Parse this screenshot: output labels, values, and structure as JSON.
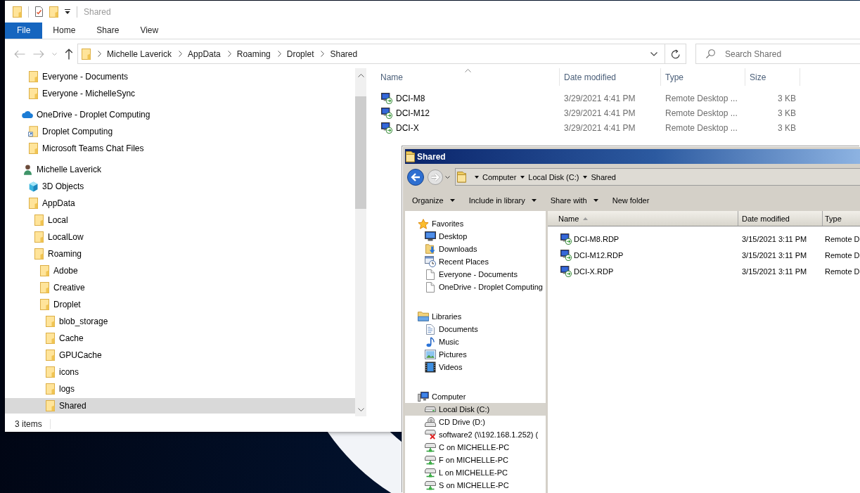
{
  "explorer": {
    "title": "Shared",
    "ribbon_tabs": [
      {
        "label": "File",
        "kind": "menu"
      },
      {
        "label": "Home",
        "kind": "tab"
      },
      {
        "label": "Share",
        "kind": "tab"
      },
      {
        "label": "View",
        "kind": "tab"
      }
    ],
    "nav_buttons": [
      {
        "kind": "back",
        "disabled": true
      },
      {
        "kind": "forward",
        "disabled": true
      },
      {
        "kind": "recent",
        "disabled": true
      },
      {
        "kind": "up",
        "disabled": false
      }
    ],
    "address": [
      "Michelle Laverick",
      "AppData",
      "Roaming",
      "Droplet",
      "Shared"
    ],
    "search": {
      "placeholder": "Search Shared"
    },
    "nav": [
      {
        "children": [
          {
            "label": "Everyone - Documents",
            "kind": "folder",
            "selected": false
          },
          {
            "label": "Everyone - MichelleSync",
            "kind": "folder",
            "selected": false
          }
        ]
      },
      {
        "label": "OneDrive - Droplet Computing",
        "kind": "cloud",
        "selected": false,
        "children": [
          {
            "label": "Droplet Computing",
            "kind": "shortcut",
            "selected": false
          },
          {
            "label": "Microsoft Teams Chat Files",
            "kind": "folder",
            "selected": false
          }
        ]
      },
      {
        "label": "Michelle Laverick",
        "kind": "user",
        "selected": false,
        "children": [
          {
            "label": "3D Objects",
            "kind": "cube",
            "selected": false
          },
          {
            "label": "AppData",
            "kind": "folder",
            "selected": false,
            "children": [
              {
                "label": "Local",
                "kind": "folder",
                "selected": false
              },
              {
                "label": "LocalLow",
                "kind": "folder",
                "selected": false
              },
              {
                "label": "Roaming",
                "kind": "folder",
                "selected": false,
                "children": [
                  {
                    "label": "Adobe",
                    "kind": "folder",
                    "selected": false
                  },
                  {
                    "label": "Creative",
                    "kind": "folder",
                    "selected": false
                  },
                  {
                    "label": "Droplet",
                    "kind": "folder",
                    "selected": false,
                    "children": [
                      {
                        "label": "blob_storage",
                        "kind": "folder",
                        "selected": false
                      },
                      {
                        "label": "Cache",
                        "kind": "folder",
                        "selected": false
                      },
                      {
                        "label": "GPUCache",
                        "kind": "folder",
                        "selected": false
                      },
                      {
                        "label": "icons",
                        "kind": "folder",
                        "selected": false
                      },
                      {
                        "label": "logs",
                        "kind": "folder",
                        "selected": false
                      },
                      {
                        "label": "Shared",
                        "kind": "folder",
                        "selected": true
                      }
                    ]
                  }
                ]
              }
            ]
          }
        ]
      }
    ],
    "columns": [
      {
        "label": "Name",
        "sorted": true
      },
      {
        "label": "Date modified",
        "sorted": false
      },
      {
        "label": "Type",
        "sorted": false
      },
      {
        "label": "Size",
        "sorted": false
      }
    ],
    "files": [
      {
        "name": "DCI-M8",
        "date_modified": "3/29/2021 4:41 PM",
        "type": "Remote Desktop ...",
        "size": "3 KB"
      },
      {
        "name": "DCI-M12",
        "date_modified": "3/29/2021 4:41 PM",
        "type": "Remote Desktop ...",
        "size": "3 KB"
      },
      {
        "name": "DCI-X",
        "date_modified": "3/29/2021 4:41 PM",
        "type": "Remote Desktop ...",
        "size": "3 KB"
      }
    ],
    "status_bar": {
      "item_count": "3 items"
    }
  },
  "legacy_explorer": {
    "title": "Shared",
    "nav_buttons": [
      {
        "kind": "back",
        "disabled": false
      },
      {
        "kind": "forward",
        "disabled": true
      },
      {
        "kind": "recent",
        "disabled": false
      }
    ],
    "address": [
      "Computer",
      "Local Disk (C:)",
      "Shared"
    ],
    "toolbar": [
      {
        "label": "Organize",
        "dropdown": true
      },
      {
        "label": "Include in library",
        "dropdown": true
      },
      {
        "label": "Share with",
        "dropdown": true
      },
      {
        "label": "New folder",
        "dropdown": false
      }
    ],
    "nav": [
      {
        "label": "Favorites",
        "kind": "star",
        "selected": false,
        "children": [
          {
            "label": "Desktop",
            "kind": "desktop",
            "selected": false
          },
          {
            "label": "Downloads",
            "kind": "downloads",
            "selected": false
          },
          {
            "label": "Recent Places",
            "kind": "recent",
            "selected": false
          },
          {
            "label": "Everyone - Documents",
            "kind": "page",
            "selected": false
          },
          {
            "label": "OneDrive - Droplet Computing",
            "kind": "page",
            "selected": false
          }
        ]
      },
      {
        "label": "Libraries",
        "kind": "library",
        "selected": false,
        "children": [
          {
            "label": "Documents",
            "kind": "documents",
            "selected": false
          },
          {
            "label": "Music",
            "kind": "music",
            "selected": false
          },
          {
            "label": "Pictures",
            "kind": "pictures",
            "selected": false
          },
          {
            "label": "Videos",
            "kind": "videos",
            "selected": false
          }
        ]
      },
      {
        "label": "Computer",
        "kind": "computer",
        "selected": false,
        "children": [
          {
            "label": "Local Disk (C:)",
            "kind": "disk",
            "selected": true
          },
          {
            "label": "CD Drive (D:)",
            "kind": "cd",
            "selected": false
          },
          {
            "label": "software2 (\\\\192.168.1.252) (",
            "kind": "offline",
            "selected": false
          },
          {
            "label": "C on MICHELLE-PC",
            "kind": "network",
            "selected": false
          },
          {
            "label": "F on MICHELLE-PC",
            "kind": "network",
            "selected": false
          },
          {
            "label": "L on MICHELLE-PC",
            "kind": "network",
            "selected": false
          },
          {
            "label": "S on MICHELLE-PC",
            "kind": "network",
            "selected": false
          }
        ]
      }
    ],
    "columns": [
      {
        "label": "Name",
        "sorted": true
      },
      {
        "label": "Date modified",
        "sorted": false
      },
      {
        "label": "Type",
        "sorted": false
      }
    ],
    "files": [
      {
        "name": "DCI-M8.RDP",
        "date_modified": "3/15/2021 3:11 PM",
        "type": "Remote D"
      },
      {
        "name": "DCI-M12.RDP",
        "date_modified": "3/15/2021 3:11 PM",
        "type": "Remote D"
      },
      {
        "name": "DCI-X.RDP",
        "date_modified": "3/15/2021 3:11 PM",
        "type": "Remote D"
      }
    ]
  }
}
